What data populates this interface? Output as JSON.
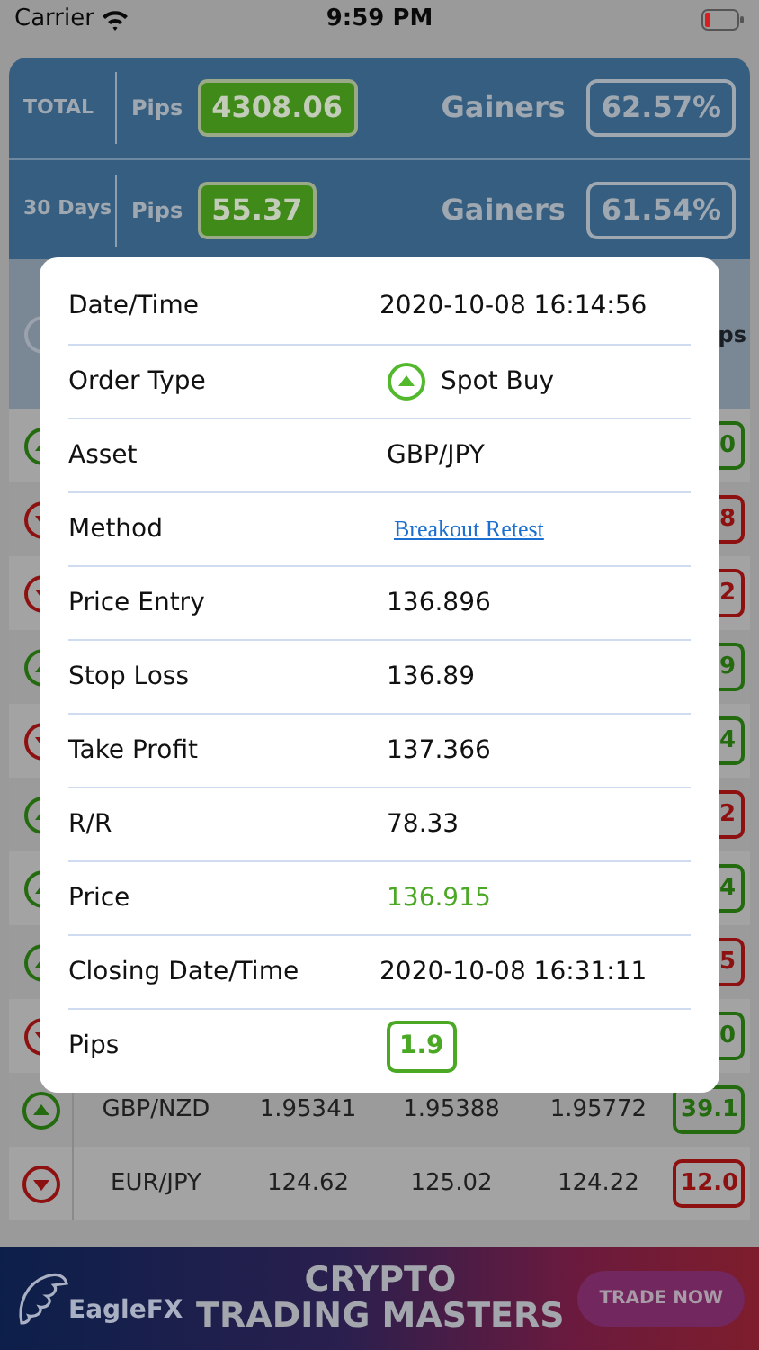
{
  "status_bar": {
    "carrier": "Carrier",
    "time": "9:59 PM"
  },
  "stats": [
    {
      "period": "TOTAL",
      "pips_label": "Pips",
      "pips": "4308.06",
      "gainers_label": "Gainers",
      "gainers": "62.57%"
    },
    {
      "period": "30 Days",
      "pips_label": "Pips",
      "pips": "55.37",
      "gainers_label": "Gainers",
      "gainers": "61.54%"
    }
  ],
  "table": {
    "header_fragment": "ps",
    "rows": [
      {
        "kind": "covered",
        "rising": true,
        "profit": true,
        "pips": "0"
      },
      {
        "kind": "covered",
        "rising": false,
        "profit": false,
        "pips": "8"
      },
      {
        "kind": "covered",
        "rising": false,
        "profit": false,
        "pips": "2"
      },
      {
        "kind": "covered",
        "rising": true,
        "profit": true,
        "pips": "9"
      },
      {
        "kind": "covered",
        "rising": false,
        "profit": true,
        "pips": "4"
      },
      {
        "kind": "covered",
        "rising": true,
        "profit": false,
        "pips": "2"
      },
      {
        "kind": "covered",
        "rising": true,
        "profit": true,
        "pips": "4"
      },
      {
        "kind": "covered",
        "rising": true,
        "profit": false,
        "pips": "5"
      },
      {
        "kind": "covered",
        "rising": false,
        "profit": true,
        "pips": "0"
      },
      {
        "kind": "full",
        "rising": true,
        "profit": true,
        "asset": "GBP/NZD",
        "column_2": "1.95341",
        "column_3": "1.95388",
        "column_4": "1.95772",
        "pips": "39.1"
      },
      {
        "kind": "full",
        "rising": false,
        "profit": false,
        "asset": "EUR/JPY",
        "column_2": "124.62",
        "column_3": "125.02",
        "column_4": "124.22",
        "pips": "12.0"
      }
    ]
  },
  "modal": {
    "rows": [
      {
        "kind": "text",
        "label": "Date/Time",
        "value": "2020-10-08 16:14:56"
      },
      {
        "kind": "order",
        "label": "Order Type",
        "value": "Spot Buy",
        "rising": true
      },
      {
        "kind": "text",
        "label": "Asset",
        "value": "GBP/JPY"
      },
      {
        "kind": "link",
        "label": "Method",
        "value": "Breakout Retest"
      },
      {
        "kind": "text",
        "label": "Price Entry",
        "value": "136.896"
      },
      {
        "kind": "text",
        "label": "Stop Loss",
        "value": "136.89"
      },
      {
        "kind": "text",
        "label": "Take Profit",
        "value": "137.366"
      },
      {
        "kind": "text",
        "label": "R/R",
        "value": "78.33"
      },
      {
        "kind": "price",
        "label": "Price",
        "value": "136.915",
        "profit": true
      },
      {
        "kind": "text",
        "label": "Closing Date/Time",
        "value": "2020-10-08 16:31:11"
      },
      {
        "kind": "pips",
        "label": "Pips",
        "value": "1.9",
        "profit": true
      }
    ]
  },
  "ad": {
    "brand": "EagleFX",
    "headline": [
      "CRYPTO",
      "TRADING MASTERS"
    ],
    "button": "TRADE NOW"
  }
}
